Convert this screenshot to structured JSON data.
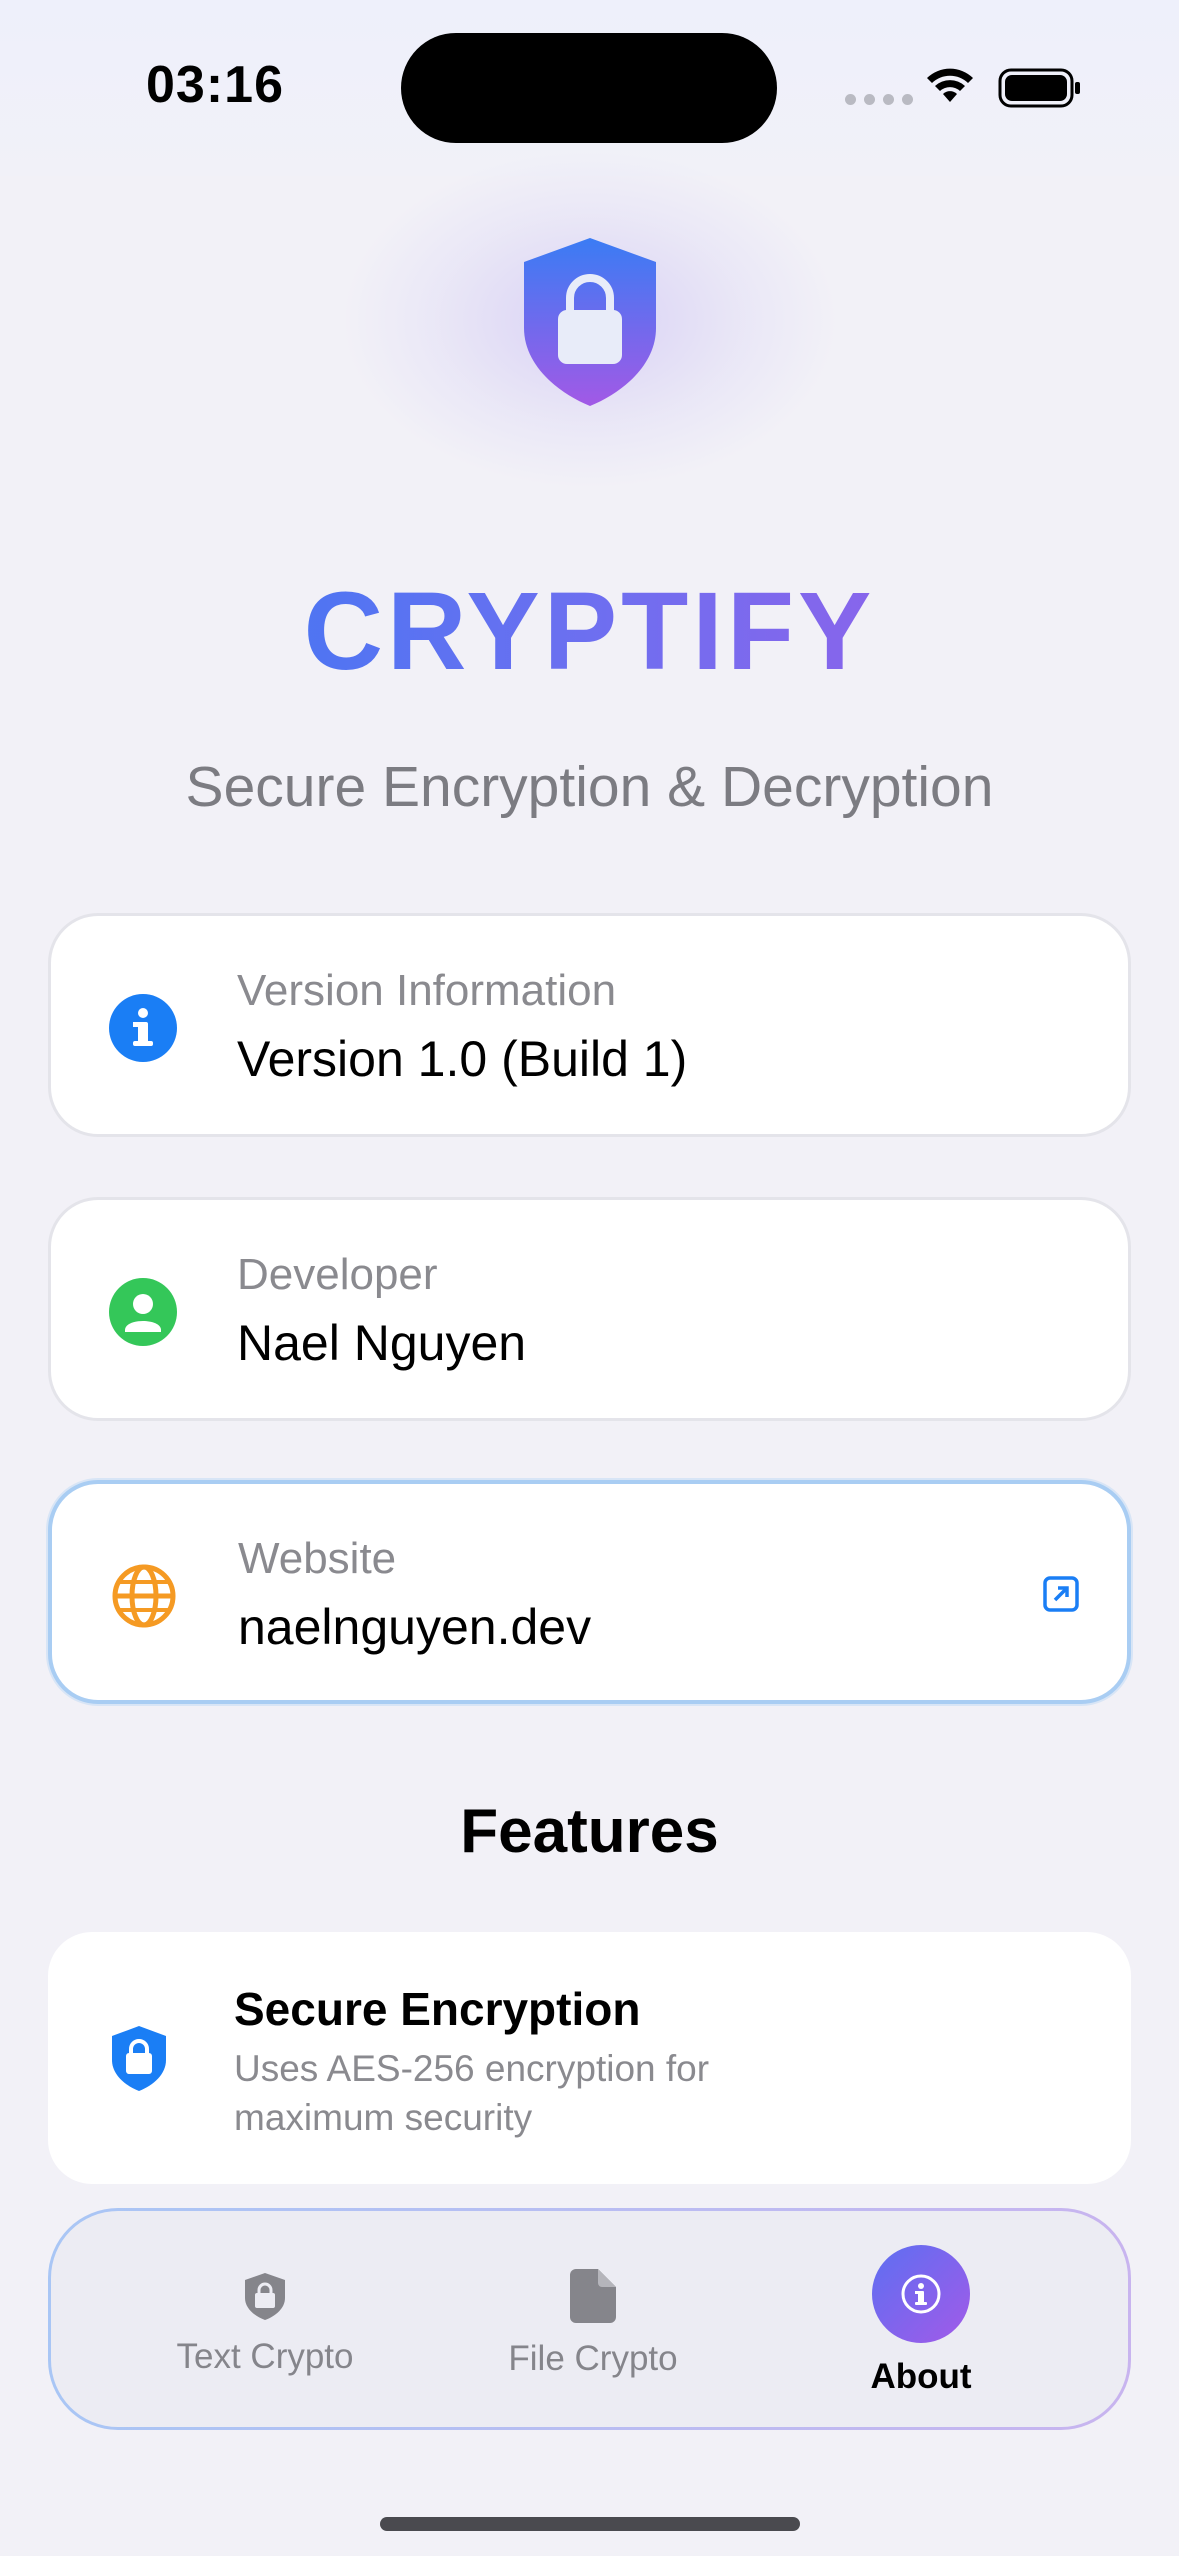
{
  "status_bar": {
    "time": "03:16",
    "icons": [
      "signal-icon",
      "wifi-icon",
      "battery-icon"
    ]
  },
  "header": {
    "logo_icon": "shield-lock-icon",
    "app_name": "CRYPTIFY",
    "subtitle": "Secure Encryption & Decryption"
  },
  "info_cards": [
    {
      "icon": "info-circle-icon",
      "icon_color": "#1a7ef5",
      "label": "Version Information",
      "value": "Version 1.0 (Build 1)"
    },
    {
      "icon": "person-circle-icon",
      "icon_color": "#34c759",
      "label": "Developer",
      "value": "Nael Nguyen"
    },
    {
      "icon": "globe-icon",
      "icon_color": "#f59a23",
      "label": "Website",
      "value": "naelnguyen.dev",
      "trailing_icon": "external-link-icon"
    }
  ],
  "features": {
    "title": "Features",
    "items": [
      {
        "icon": "shield-lock-icon",
        "title": "Secure Encryption",
        "description": "Uses AES-256 encryption for maximum security"
      }
    ]
  },
  "tab_bar": {
    "tabs": [
      {
        "label": "Text Crypto",
        "icon": "shield-lock-icon",
        "active": false
      },
      {
        "label": "File Crypto",
        "icon": "document-icon",
        "active": false
      },
      {
        "label": "About",
        "icon": "info-icon",
        "active": true
      }
    ]
  },
  "colors": {
    "accent_blue": "#1a7ef5",
    "accent_purple": "#a45ae6",
    "background": "#f2f1f7"
  }
}
